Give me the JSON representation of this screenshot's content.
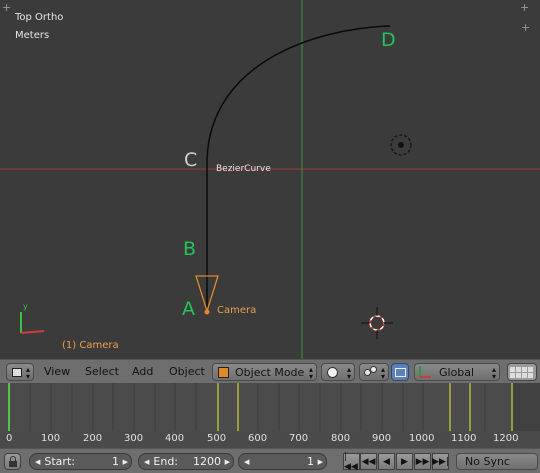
{
  "viewport": {
    "view_name": "Top Ortho",
    "units": "Meters",
    "curve_label": "BezierCurve",
    "camera_label": "Camera",
    "selected_object": "(1) Camera",
    "axis_y_label": "y",
    "points": {
      "a": "A",
      "b": "B",
      "c": "C",
      "d": "D"
    },
    "colors": {
      "point_green": "#22c35a",
      "curve": "#0a0a0a",
      "camera_orange": "#e08a2a",
      "grid_red": "#9c3a3a",
      "grid_green": "#3f8f3f"
    }
  },
  "header": {
    "menus": [
      "View",
      "Select",
      "Add",
      "Object"
    ],
    "mode": "Object Mode",
    "orientation": "Global",
    "icons": [
      "editor-type-icon",
      "shading-sphere-icon",
      "pivot-icon",
      "snap-icon",
      "transform-orientation-icon",
      "layers-icon"
    ]
  },
  "timeline": {
    "ticks": [
      "0",
      "100",
      "200",
      "300",
      "400",
      "500",
      "600",
      "700",
      "800",
      "900",
      "1000",
      "1100",
      "1200"
    ]
  },
  "footer": {
    "start_label": "Start:",
    "start_value": "1",
    "end_label": "End:",
    "end_value": "1200",
    "current_frame": "1",
    "sync": "No Sync",
    "playback_icons": [
      "jump-start-icon",
      "prev-keyframe-icon",
      "play-reverse-icon",
      "play-icon",
      "next-keyframe-icon",
      "jump-end-icon"
    ]
  }
}
